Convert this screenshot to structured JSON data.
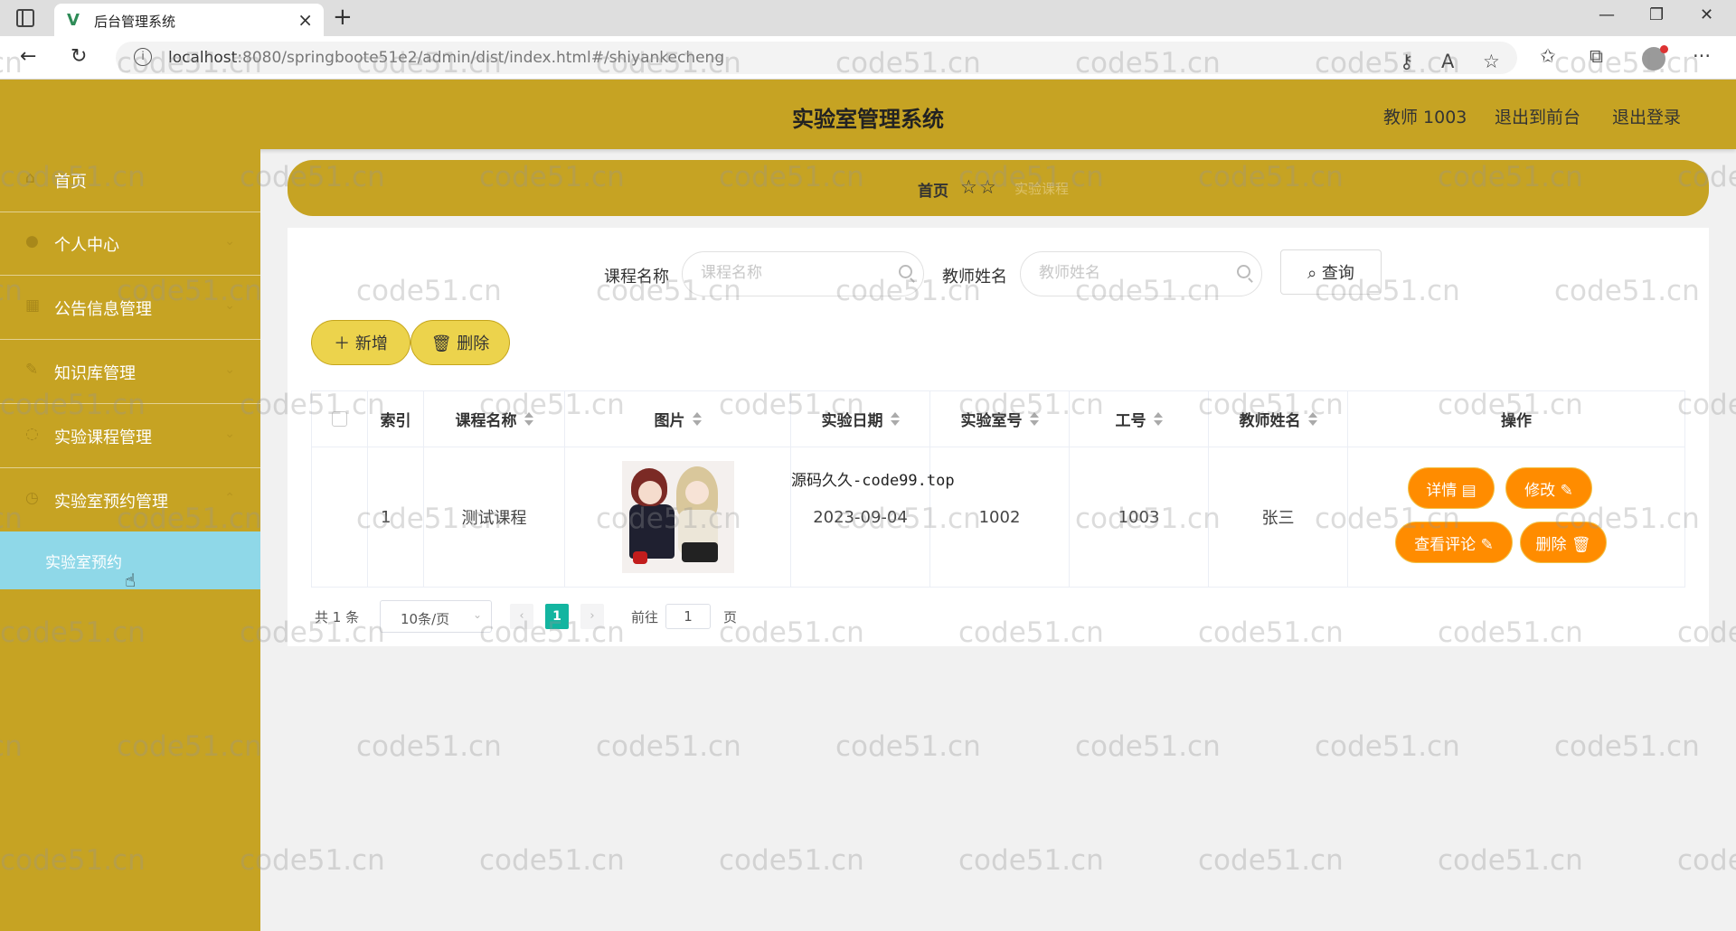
{
  "browser": {
    "tab_title": "后台管理系统",
    "url_host": "localhost",
    "url_rest": ":8080/springboote51e2/admin/dist/index.html#/shiyankecheng"
  },
  "header": {
    "title": "实验室管理系统",
    "user": "教师 1003",
    "front_link": "退出到前台",
    "logout_link": "退出登录"
  },
  "sidebar": {
    "items": [
      {
        "label": "首页",
        "icon": "home-icon"
      },
      {
        "label": "个人中心",
        "icon": "user-icon"
      },
      {
        "label": "公告信息管理",
        "icon": "notice-icon"
      },
      {
        "label": "知识库管理",
        "icon": "book-icon"
      },
      {
        "label": "实验课程管理",
        "icon": "course-icon"
      },
      {
        "label": "实验室预约管理",
        "icon": "calendar-icon"
      }
    ],
    "active_sub": "实验室预约"
  },
  "breadcrumb": {
    "home": "首页",
    "stars": "☆☆",
    "current": "实验课程"
  },
  "search": {
    "course_label": "课程名称",
    "course_placeholder": "课程名称",
    "teacher_label": "教师姓名",
    "teacher_placeholder": "教师姓名",
    "query_label": "查询"
  },
  "actions": {
    "add_label": "新增",
    "delete_label": "删除"
  },
  "table": {
    "headers": [
      "索引",
      "课程名称",
      "图片",
      "实验日期",
      "实验室号",
      "工号",
      "教师姓名",
      "操作"
    ],
    "rows": [
      {
        "index": "1",
        "course": "测试课程",
        "date": "2023-09-04",
        "room": "1002",
        "job_no": "1003",
        "teacher": "张三"
      }
    ],
    "ops": {
      "detail": "详情",
      "edit": "修改",
      "comments": "查看评论",
      "delete": "删除"
    }
  },
  "source_watermark": "源码久久-code99.top",
  "pagination": {
    "total": "共 1 条",
    "page_size": "10条/页",
    "current_page": "1",
    "goto_label": "前往",
    "goto_value": "1",
    "page_suffix": "页"
  },
  "watermark_text": "code51.cn",
  "colors": {
    "theme": "#c6a323",
    "orange_button": "#ff8c00",
    "active_submenu": "#8fd8e8",
    "pager_active": "#13b5a0"
  }
}
